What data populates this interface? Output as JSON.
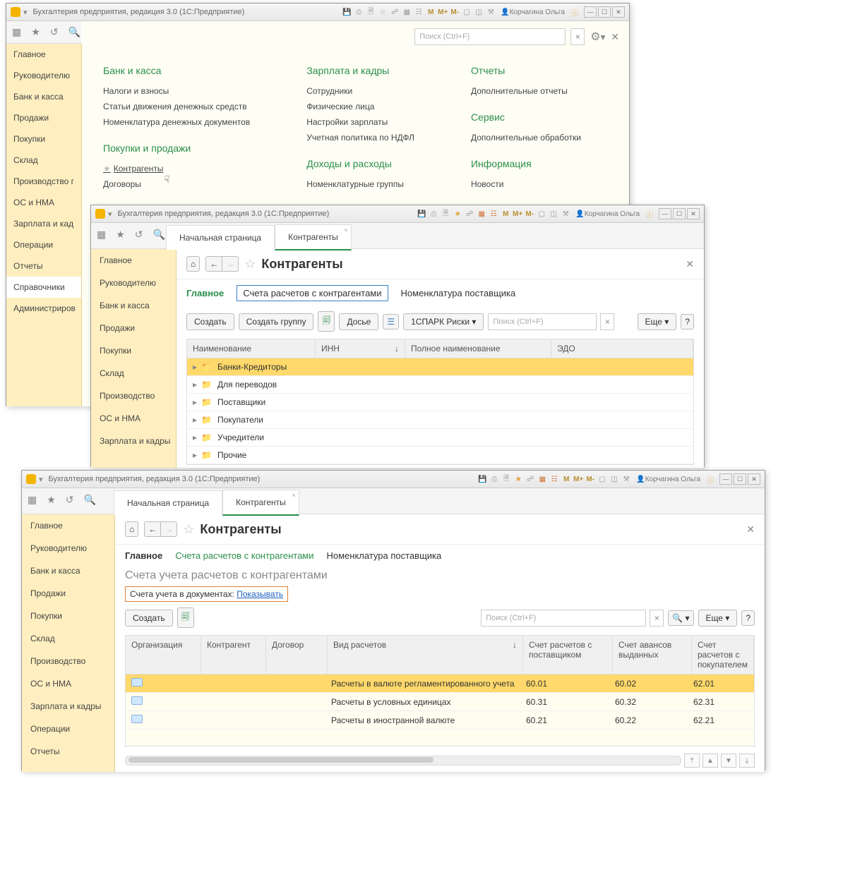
{
  "app_title": "Бухгалтерия предприятия, редакция 3.0  (1С:Предприятие)",
  "user": "Корчагина Ольга",
  "M_labels": [
    "M",
    "M+",
    "M-"
  ],
  "search_placeholder": "Поиск (Ctrl+F)",
  "w1": {
    "sidebar": [
      "Главное",
      "Руководителю",
      "Банк и касса",
      "Продажи",
      "Покупки",
      "Склад",
      "Производство г",
      "ОС и НМА",
      "Зарплата и кад",
      "Операции",
      "Отчеты",
      "Справочники",
      "Администриров"
    ],
    "cols": {
      "bank": {
        "title": "Банк и касса",
        "items": [
          "Налоги и взносы",
          "Статьи движения денежных средств",
          "Номенклатура денежных документов"
        ]
      },
      "buy": {
        "title": "Покупки и продажи",
        "items": [
          "Контрагенты",
          "Договоры"
        ]
      },
      "sal": {
        "title": "Зарплата и кадры",
        "items": [
          "Сотрудники",
          "Физические лица",
          "Настройки зарплаты",
          "Учетная политика по НДФЛ"
        ]
      },
      "inc": {
        "title": "Доходы и расходы",
        "items": [
          "Номенклатурные группы"
        ]
      },
      "rep": {
        "title": "Отчеты",
        "items": [
          "Дополнительные отчеты"
        ]
      },
      "srv": {
        "title": "Сервис",
        "items": [
          "Дополнительные обработки"
        ]
      },
      "info": {
        "title": "Информация",
        "items": [
          "Новости"
        ]
      }
    }
  },
  "w2": {
    "sidebar": [
      "Главное",
      "Руководителю",
      "Банк и касса",
      "Продажи",
      "Покупки",
      "Склад",
      "Производство",
      "ОС и НМА",
      "Зарплата и кадры"
    ],
    "tabs": [
      "Начальная страница",
      "Контрагенты"
    ],
    "page_title": "Контрагенты",
    "subtabs": [
      "Главное",
      "Счета расчетов с контрагентами",
      "Номенклатура поставщика"
    ],
    "buttons": {
      "create": "Создать",
      "create_group": "Создать группу",
      "dosie": "Досье",
      "spark": "1СПАРК Риски",
      "more": "Еще"
    },
    "columns": [
      "Наименование",
      "ИНН",
      "Полное наименование",
      "ЭДО"
    ],
    "rows": [
      "Банки-Кредиторы",
      "Для переводов",
      "Поставщики",
      "Покупатели",
      "Учредители",
      "Прочие"
    ]
  },
  "w3": {
    "sidebar": [
      "Главное",
      "Руководителю",
      "Банк и касса",
      "Продажи",
      "Покупки",
      "Склад",
      "Производство",
      "ОС и НМА",
      "Зарплата и кадры",
      "Операции",
      "Отчеты"
    ],
    "tabs": [
      "Начальная страница",
      "Контрагенты"
    ],
    "page_title": "Контрагенты",
    "subtabs": [
      "Главное",
      "Счета расчетов с контрагентами",
      "Номенклатура поставщика"
    ],
    "heading": "Счета учета расчетов с контрагентами",
    "link_prefix": "Счета учета в документах: ",
    "link_text": "Показывать",
    "buttons": {
      "create": "Создать",
      "more": "Еще"
    },
    "columns": [
      "Организация",
      "Контрагент",
      "Договор",
      "Вид расчетов",
      "Счет расчетов с поставщиком",
      "Счет авансов выданных",
      "Счет расчетов с покупателем"
    ],
    "rows": [
      {
        "vid": "Расчеты в валюте регламентированного учета",
        "c1": "60.01",
        "c2": "60.02",
        "c3": "62.01"
      },
      {
        "vid": "Расчеты в условных единицах",
        "c1": "60.31",
        "c2": "60.32",
        "c3": "62.31"
      },
      {
        "vid": "Расчеты в иностранной валюте",
        "c1": "60.21",
        "c2": "60.22",
        "c3": "62.21"
      }
    ]
  }
}
